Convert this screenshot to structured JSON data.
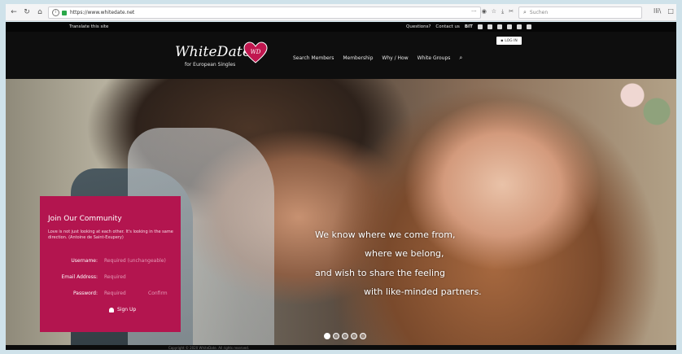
{
  "browser": {
    "back_icon": "back-arrow-icon",
    "reload_icon": "reload-icon",
    "home_icon": "home-icon",
    "url": "https://www.whitedate.net",
    "url_more": "···",
    "search_placeholder": "Suchen",
    "library_label": "lli\\",
    "sidebar_label": "□"
  },
  "site": {
    "translate_label": "Translate this site",
    "questions_label": "Questions?",
    "contact_label": "Contact us",
    "bit_label": "BIT",
    "login_label": "LOG IN",
    "logo_text": "WhiteDate",
    "logo_sub": "for European Singles",
    "logo_badge": "WD",
    "nav": [
      "Search Members",
      "Membership",
      "Why / How",
      "White Groups"
    ]
  },
  "community": {
    "title": "Join Our Community",
    "quote": "Love is not just looking at each other. It's looking in the same direction. (Antoine de Saint-Exupery)",
    "username_label": "Username:",
    "username_placeholder": "Required (unchangeable)",
    "email_label": "Email Address:",
    "email_placeholder": "Required",
    "password_label": "Password:",
    "password_placeholder": "Required",
    "confirm_placeholder": "Confirm",
    "signup_label": "Sign Up"
  },
  "hero": {
    "line1": "We know where we come from,",
    "line2": "where we belong,",
    "line3": "and wish to share the feeling",
    "line4": "with like-minded partners.",
    "slides": 5,
    "active_slide": 1
  },
  "footer": {
    "text": "Copyright © 2020 WhiteDate. All rights reserved."
  },
  "colors": {
    "accent": "#b3154f",
    "header_bg": "#0e0e0e",
    "topbar_bg": "#060606"
  }
}
